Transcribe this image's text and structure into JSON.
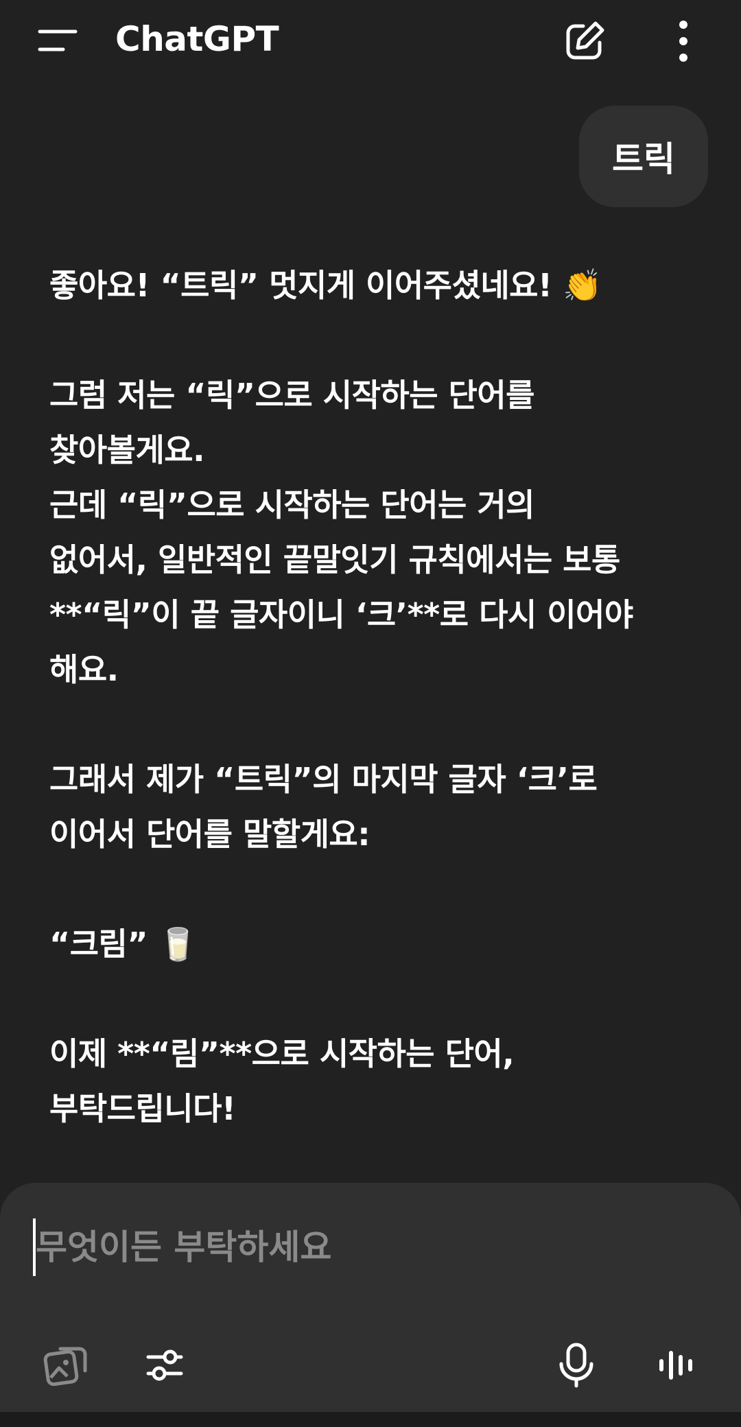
{
  "header": {
    "title": "ChatGPT",
    "menu_icon": "hamburger-menu-icon",
    "new_chat_icon": "edit-pencil-icon",
    "more_icon": "vertical-dots-icon"
  },
  "user_message": "트릭",
  "assistant_message": {
    "p1": "좋아요! “트릭” 멋지게 이어주셨네요! 👏",
    "p2_line1": "그럼 저는 “릭”으로 시작하는 단어를",
    "p2_line2": "찾아볼게요.",
    "p2_line3": "근데 “릭”으로 시작하는 단어는 거의",
    "p2_line4": "없어서, 일반적인 끝말잇기 규칙에서는 보통",
    "p2_line5": "**“릭”이 끝 글자이니 ‘크’**로 다시 이어야",
    "p2_line6": "해요.",
    "p3_line1": "그래서 제가 “트릭”의 마지막 글자 ‘크’로",
    "p3_line2": "이어서 단어를 말할게요:",
    "p4": "“크림” 🥛",
    "p5_line1": "이제 **“림”**으로 시작하는 단어,",
    "p5_line2": "부탁드립니다!"
  },
  "composer": {
    "placeholder": "무엇이든 부탁하세요",
    "icons": [
      "image-gallery-icon",
      "sliders-settings-icon",
      "microphone-icon",
      "voice-waveform-icon"
    ]
  },
  "colors": {
    "background": "#212121",
    "bubble": "#303030",
    "text": "#ffffff",
    "placeholder": "#8a8a8a"
  }
}
